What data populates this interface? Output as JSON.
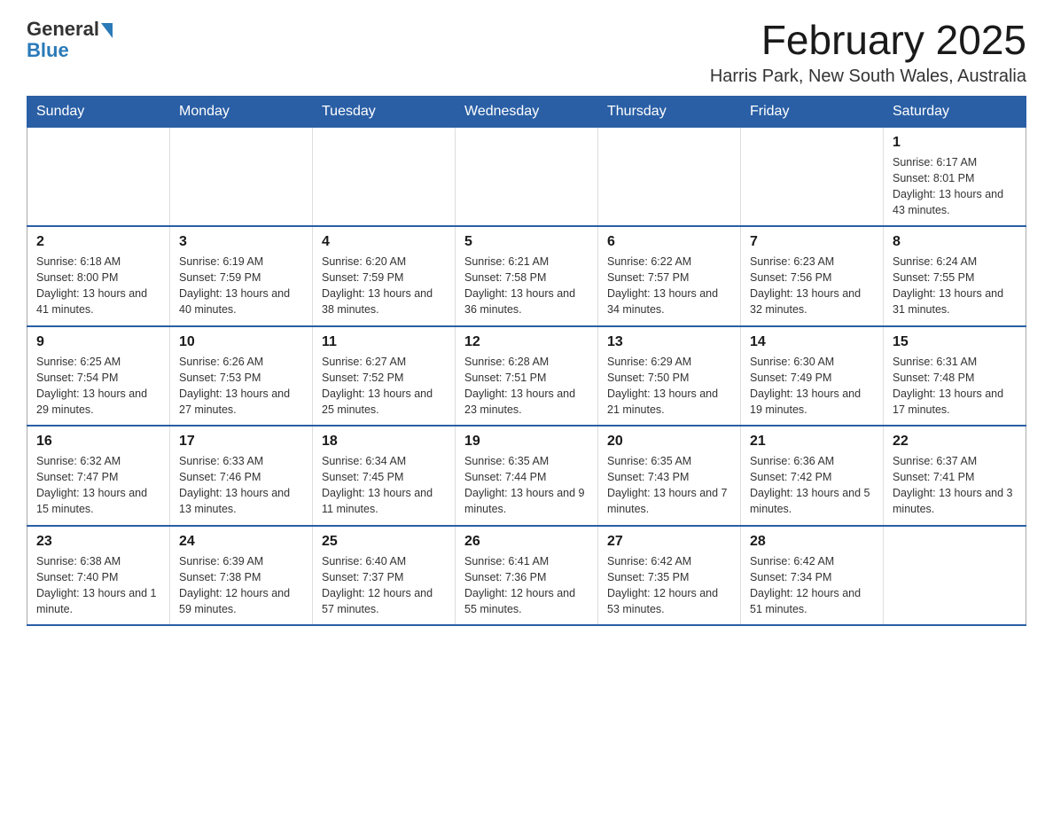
{
  "header": {
    "logo_general": "General",
    "logo_blue": "Blue",
    "month_title": "February 2025",
    "location": "Harris Park, New South Wales, Australia"
  },
  "days_of_week": [
    "Sunday",
    "Monday",
    "Tuesday",
    "Wednesday",
    "Thursday",
    "Friday",
    "Saturday"
  ],
  "weeks": [
    {
      "days": [
        {
          "number": "",
          "info": ""
        },
        {
          "number": "",
          "info": ""
        },
        {
          "number": "",
          "info": ""
        },
        {
          "number": "",
          "info": ""
        },
        {
          "number": "",
          "info": ""
        },
        {
          "number": "",
          "info": ""
        },
        {
          "number": "1",
          "info": "Sunrise: 6:17 AM\nSunset: 8:01 PM\nDaylight: 13 hours and 43 minutes."
        }
      ]
    },
    {
      "days": [
        {
          "number": "2",
          "info": "Sunrise: 6:18 AM\nSunset: 8:00 PM\nDaylight: 13 hours and 41 minutes."
        },
        {
          "number": "3",
          "info": "Sunrise: 6:19 AM\nSunset: 7:59 PM\nDaylight: 13 hours and 40 minutes."
        },
        {
          "number": "4",
          "info": "Sunrise: 6:20 AM\nSunset: 7:59 PM\nDaylight: 13 hours and 38 minutes."
        },
        {
          "number": "5",
          "info": "Sunrise: 6:21 AM\nSunset: 7:58 PM\nDaylight: 13 hours and 36 minutes."
        },
        {
          "number": "6",
          "info": "Sunrise: 6:22 AM\nSunset: 7:57 PM\nDaylight: 13 hours and 34 minutes."
        },
        {
          "number": "7",
          "info": "Sunrise: 6:23 AM\nSunset: 7:56 PM\nDaylight: 13 hours and 32 minutes."
        },
        {
          "number": "8",
          "info": "Sunrise: 6:24 AM\nSunset: 7:55 PM\nDaylight: 13 hours and 31 minutes."
        }
      ]
    },
    {
      "days": [
        {
          "number": "9",
          "info": "Sunrise: 6:25 AM\nSunset: 7:54 PM\nDaylight: 13 hours and 29 minutes."
        },
        {
          "number": "10",
          "info": "Sunrise: 6:26 AM\nSunset: 7:53 PM\nDaylight: 13 hours and 27 minutes."
        },
        {
          "number": "11",
          "info": "Sunrise: 6:27 AM\nSunset: 7:52 PM\nDaylight: 13 hours and 25 minutes."
        },
        {
          "number": "12",
          "info": "Sunrise: 6:28 AM\nSunset: 7:51 PM\nDaylight: 13 hours and 23 minutes."
        },
        {
          "number": "13",
          "info": "Sunrise: 6:29 AM\nSunset: 7:50 PM\nDaylight: 13 hours and 21 minutes."
        },
        {
          "number": "14",
          "info": "Sunrise: 6:30 AM\nSunset: 7:49 PM\nDaylight: 13 hours and 19 minutes."
        },
        {
          "number": "15",
          "info": "Sunrise: 6:31 AM\nSunset: 7:48 PM\nDaylight: 13 hours and 17 minutes."
        }
      ]
    },
    {
      "days": [
        {
          "number": "16",
          "info": "Sunrise: 6:32 AM\nSunset: 7:47 PM\nDaylight: 13 hours and 15 minutes."
        },
        {
          "number": "17",
          "info": "Sunrise: 6:33 AM\nSunset: 7:46 PM\nDaylight: 13 hours and 13 minutes."
        },
        {
          "number": "18",
          "info": "Sunrise: 6:34 AM\nSunset: 7:45 PM\nDaylight: 13 hours and 11 minutes."
        },
        {
          "number": "19",
          "info": "Sunrise: 6:35 AM\nSunset: 7:44 PM\nDaylight: 13 hours and 9 minutes."
        },
        {
          "number": "20",
          "info": "Sunrise: 6:35 AM\nSunset: 7:43 PM\nDaylight: 13 hours and 7 minutes."
        },
        {
          "number": "21",
          "info": "Sunrise: 6:36 AM\nSunset: 7:42 PM\nDaylight: 13 hours and 5 minutes."
        },
        {
          "number": "22",
          "info": "Sunrise: 6:37 AM\nSunset: 7:41 PM\nDaylight: 13 hours and 3 minutes."
        }
      ]
    },
    {
      "days": [
        {
          "number": "23",
          "info": "Sunrise: 6:38 AM\nSunset: 7:40 PM\nDaylight: 13 hours and 1 minute."
        },
        {
          "number": "24",
          "info": "Sunrise: 6:39 AM\nSunset: 7:38 PM\nDaylight: 12 hours and 59 minutes."
        },
        {
          "number": "25",
          "info": "Sunrise: 6:40 AM\nSunset: 7:37 PM\nDaylight: 12 hours and 57 minutes."
        },
        {
          "number": "26",
          "info": "Sunrise: 6:41 AM\nSunset: 7:36 PM\nDaylight: 12 hours and 55 minutes."
        },
        {
          "number": "27",
          "info": "Sunrise: 6:42 AM\nSunset: 7:35 PM\nDaylight: 12 hours and 53 minutes."
        },
        {
          "number": "28",
          "info": "Sunrise: 6:42 AM\nSunset: 7:34 PM\nDaylight: 12 hours and 51 minutes."
        },
        {
          "number": "",
          "info": ""
        }
      ]
    }
  ]
}
